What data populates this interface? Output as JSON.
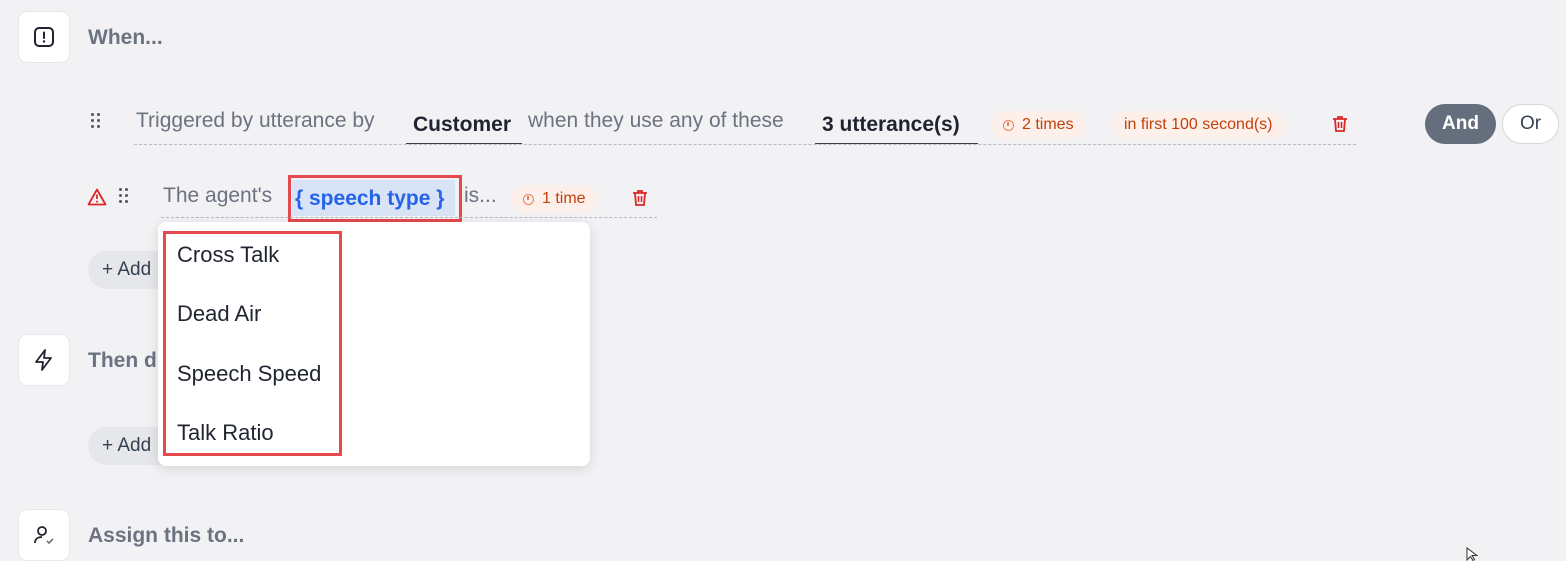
{
  "when": {
    "title": "When...",
    "icon": "alert-square-icon"
  },
  "rule1": {
    "prefix": "Triggered by utterance by",
    "speaker": "Customer",
    "middle": "when they use any of these",
    "utterances": "3 utterance(s)",
    "times_chip": "2 times",
    "window_chip": "in first 100 second(s)"
  },
  "logic": {
    "and_label": "And",
    "or_label": "Or"
  },
  "rule2": {
    "prefix": "The agent's",
    "placeholder": "{ speech type }",
    "suffix": "is...",
    "times_chip": "1 time"
  },
  "dropdown": {
    "options": [
      "Cross Talk",
      "Dead Air",
      "Speech Speed",
      "Talk Ratio"
    ]
  },
  "add_condition_label": "+ Add",
  "then": {
    "title_partial": "Then d",
    "icon": "lightning-icon"
  },
  "add_action_label": "+ Add",
  "assign": {
    "title": "Assign this to...",
    "icon": "user-check-icon"
  },
  "colors": {
    "accent_dark": "#6b7280",
    "chip_bg": "#fdf0ea",
    "chip_text": "#c2410c",
    "highlight_red": "#e5484d",
    "placeholder_blue": "#2563eb"
  }
}
